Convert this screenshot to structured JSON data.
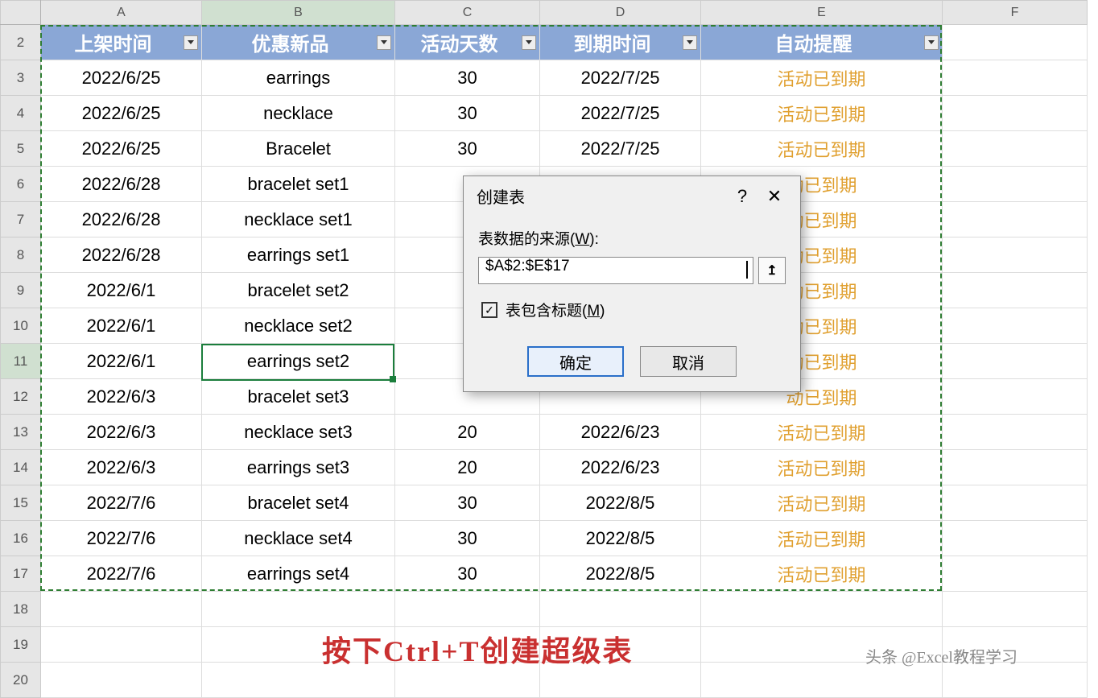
{
  "columns": [
    "A",
    "B",
    "C",
    "D",
    "E",
    "F"
  ],
  "rowNumbers": [
    2,
    3,
    4,
    5,
    6,
    7,
    8,
    9,
    10,
    11,
    12,
    13,
    14,
    15,
    16,
    17,
    18,
    19,
    20
  ],
  "headers": {
    "A": "上架时间",
    "B": "优惠新品",
    "C": "活动天数",
    "D": "到期时间",
    "E": "自动提醒"
  },
  "rows": [
    {
      "A": "2022/6/25",
      "B": "earrings",
      "C": "30",
      "D": "2022/7/25",
      "E": "活动已到期"
    },
    {
      "A": "2022/6/25",
      "B": "necklace",
      "C": "30",
      "D": "2022/7/25",
      "E": "活动已到期"
    },
    {
      "A": "2022/6/25",
      "B": "Bracelet",
      "C": "30",
      "D": "2022/7/25",
      "E": "活动已到期"
    },
    {
      "A": "2022/6/28",
      "B": "bracelet set1",
      "C": "",
      "D": "",
      "E": "动已到期"
    },
    {
      "A": "2022/6/28",
      "B": "necklace set1",
      "C": "",
      "D": "",
      "E": "动已到期"
    },
    {
      "A": "2022/6/28",
      "B": "earrings set1",
      "C": "",
      "D": "",
      "E": "动已到期"
    },
    {
      "A": "2022/6/1",
      "B": "bracelet set2",
      "C": "",
      "D": "",
      "E": "动已到期"
    },
    {
      "A": "2022/6/1",
      "B": "necklace set2",
      "C": "",
      "D": "",
      "E": "动已到期"
    },
    {
      "A": "2022/6/1",
      "B": "earrings set2",
      "C": "",
      "D": "",
      "E": "动已到期"
    },
    {
      "A": "2022/6/3",
      "B": "bracelet set3",
      "C": "",
      "D": "",
      "E": "动已到期"
    },
    {
      "A": "2022/6/3",
      "B": "necklace set3",
      "C": "20",
      "D": "2022/6/23",
      "E": "活动已到期"
    },
    {
      "A": "2022/6/3",
      "B": "earrings set3",
      "C": "20",
      "D": "2022/6/23",
      "E": "活动已到期"
    },
    {
      "A": "2022/7/6",
      "B": "bracelet set4",
      "C": "30",
      "D": "2022/8/5",
      "E": "活动已到期"
    },
    {
      "A": "2022/7/6",
      "B": "necklace set4",
      "C": "30",
      "D": "2022/8/5",
      "E": "活动已到期"
    },
    {
      "A": "2022/7/6",
      "B": "earrings set4",
      "C": "30",
      "D": "2022/8/5",
      "E": "活动已到期"
    }
  ],
  "dialog": {
    "title": "创建表",
    "help": "?",
    "close": "✕",
    "sourceLabel": "表数据的来源(",
    "sourceLabelU": "W",
    "sourceLabelEnd": "):",
    "rangeValue": "$A$2:$E$17",
    "collapseIcon": "↥",
    "checkLabel": "表包含标题(",
    "checkLabelU": "M",
    "checkLabelEnd": ")",
    "checkMark": "✓",
    "ok": "确定",
    "cancel": "取消"
  },
  "caption": "按下Ctrl+T创建超级表",
  "watermark": "头条 @Excel教程学习",
  "activeCell": "B11"
}
